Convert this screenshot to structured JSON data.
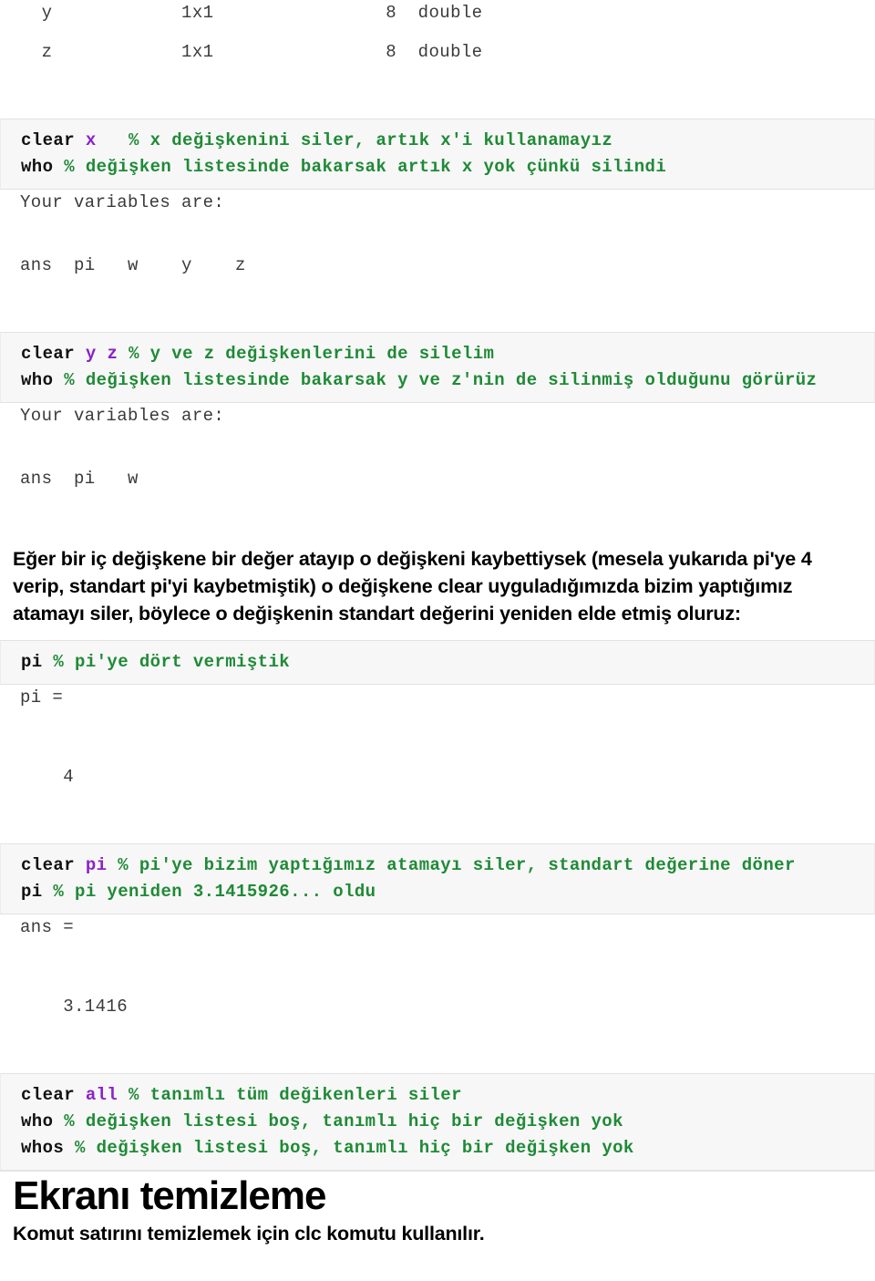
{
  "document": {
    "language": "tr",
    "colors": {
      "keyword": "#111111",
      "variable": "#8b22c9",
      "comment": "#1f8a36",
      "output_text": "#3a3a3a",
      "code_background": "#f7f7f7",
      "code_border": "#e2e2e2",
      "page_background": "#ffffff"
    }
  },
  "whos_table": {
    "rows": [
      {
        "name": "y",
        "size": "1x1",
        "bytes": "8",
        "class": "double"
      },
      {
        "name": "z",
        "size": "1x1",
        "bytes": "8",
        "class": "double"
      }
    ],
    "row1_text": "  y            1x1                8  double",
    "row2_text": "  z            1x1                8  double"
  },
  "block1": {
    "line1": {
      "keyword": "clear",
      "variable": "x",
      "comment": "% x değişkenini siler, artık x'i kullanamayız"
    },
    "line2": {
      "keyword": "who",
      "comment": "% değişken listesinde bakarsak artık x yok çünkü silindi"
    }
  },
  "output1": {
    "header": "Your variables are:",
    "variables": "ans  pi   w    y    z",
    "variable_list": [
      "ans",
      "pi",
      "w",
      "y",
      "z"
    ]
  },
  "block2": {
    "line1": {
      "keyword": "clear",
      "variable1": "y",
      "variable2": "z",
      "comment": "% y ve z değişkenlerini de silelim"
    },
    "line2": {
      "keyword": "who",
      "comment": "% değişken listesinde bakarsak y ve z'nin de silinmiş olduğunu görürüz"
    }
  },
  "output2": {
    "header": "Your variables are:",
    "variables": "ans  pi   w",
    "variable_list": [
      "ans",
      "pi",
      "w"
    ]
  },
  "paragraph1": "Eğer bir iç değişkene bir değer atayıp o değişkeni kaybettiysek (mesela yukarıda pi'ye 4 verip, standart pi'yi kaybetmiştik) o değişkene clear uyguladığımızda bizim yaptığımız atamayı siler, böylece o değişkenin standart değerini yeniden elde etmiş oluruz:",
  "block3": {
    "line1": {
      "keyword": "pi",
      "comment": "% pi'ye dört vermiştik"
    }
  },
  "output3": {
    "label": "pi =",
    "value": "    4"
  },
  "block4": {
    "line1": {
      "keyword": "clear",
      "variable": "pi",
      "comment": "% pi'ye bizim yaptığımız atamayı siler, standart değerine döner"
    },
    "line2": {
      "keyword": "pi",
      "comment": "% pi yeniden 3.1415926... oldu"
    }
  },
  "output4": {
    "label": "ans =",
    "value": "    3.1416"
  },
  "block5": {
    "line1": {
      "keyword": "clear",
      "variable": "all",
      "comment": "% tanımlı tüm değikenleri siler"
    },
    "line2": {
      "keyword": "who",
      "comment": "% değişken listesi boş, tanımlı hiç bir değişken yok"
    },
    "line3": {
      "keyword": "whos",
      "comment": "% değişken listesi boş, tanımlı hiç bir değişken yok"
    }
  },
  "section": {
    "heading": "Ekranı temizleme",
    "subparagraph": "Komut satırını temizlemek için clc komutu kullanılır."
  }
}
